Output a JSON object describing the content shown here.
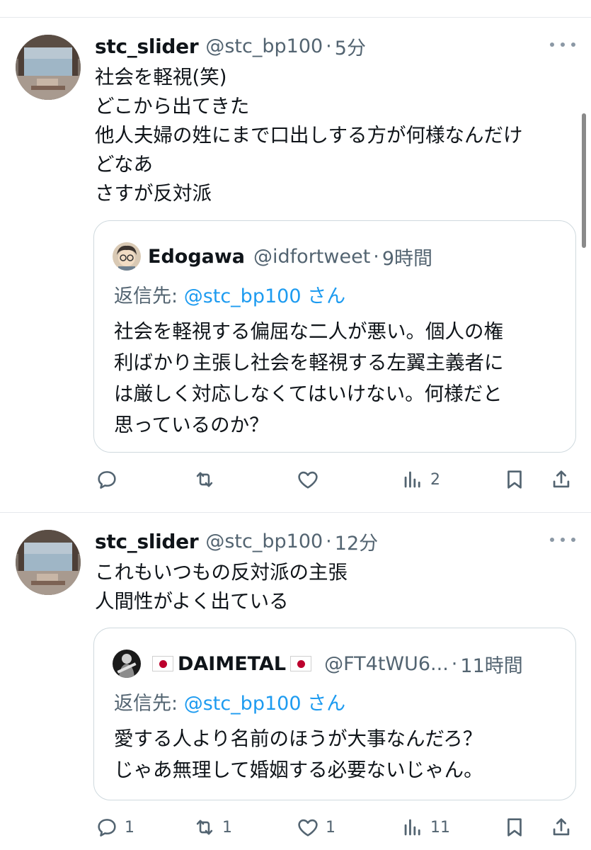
{
  "tweets": [
    {
      "display_name": "stc_slider",
      "handle": "@stc_bp100",
      "separator": "·",
      "time": "5分",
      "lines": [
        "社会を軽視(笑)",
        "どこから出てきた",
        "他人夫婦の姓にまで口出しする方が何様なんだけ",
        "どなあ",
        "さすが反対派"
      ],
      "quote": {
        "display_name": "Edogawa",
        "handle": "@idfortweet",
        "separator": "·",
        "time": "9時間",
        "reply_prefix": "返信先: ",
        "reply_mention": "@stc_bp100 さん",
        "lines": [
          "社会を軽視する偏屈な二人が悪い。個人の権",
          "利ばかり主張し社会を軽視する左翼主義者に",
          "は厳しく対応しなくてはいけない。何様だと",
          "思っているのか？"
        ]
      },
      "actions": {
        "replies": "",
        "reposts": "",
        "likes": "",
        "views": "2"
      }
    },
    {
      "display_name": "stc_slider",
      "handle": "@stc_bp100",
      "separator": "·",
      "time": "12分",
      "lines": [
        "これもいつもの反対派の主張",
        "人間性がよく出ている"
      ],
      "quote": {
        "display_name": "DAIMETAL",
        "handle": "@FT4tWU6...",
        "separator": "·",
        "time": "11時間",
        "reply_prefix": "返信先: ",
        "reply_mention": "@stc_bp100 さん",
        "lines": [
          "愛する人より名前のほうが大事なんだろ？",
          "じゃあ無理して婚姻する必要ないじゃん。"
        ]
      },
      "actions": {
        "replies": "1",
        "reposts": "1",
        "likes": "1",
        "views": "11"
      }
    }
  ],
  "icons": {
    "reply": "reply-icon",
    "repost": "repost-icon",
    "like": "heart-icon",
    "views": "views-icon",
    "bookmark": "bookmark-icon",
    "share": "share-icon",
    "more": "more-icon",
    "flag": "japan-flag-icon"
  },
  "colors": {
    "text": "#0f1419",
    "secondary": "#536471",
    "link": "#1d9bf0",
    "border": "#cfd9de",
    "divider": "#e6e9ec"
  }
}
